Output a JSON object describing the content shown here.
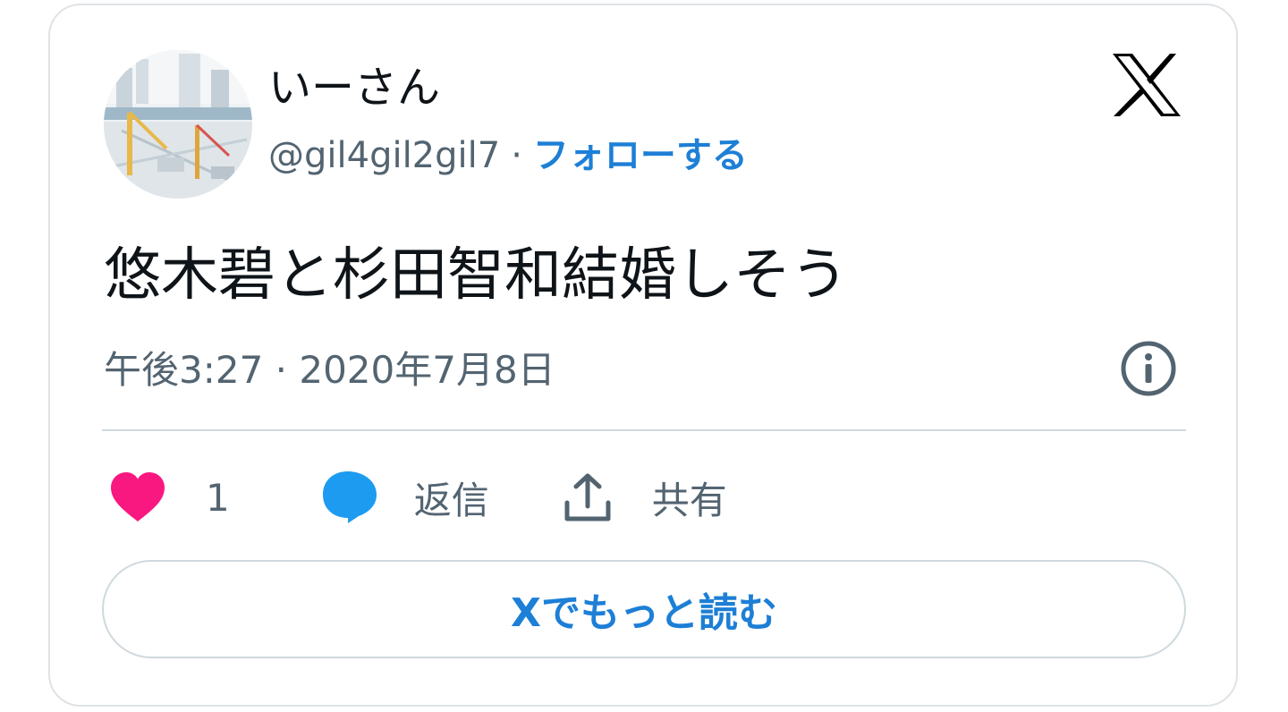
{
  "author": {
    "display_name": "いーさん",
    "handle": "@gil4gil2gil7",
    "separator": "·",
    "follow_label": "フォローする"
  },
  "tweet": {
    "text": "悠木碧と杉田智和結婚しそう",
    "timestamp": "午後3:27 · 2020年7月8日"
  },
  "actions": {
    "like_count": "1",
    "reply_label": "返信",
    "share_label": "共有"
  },
  "read_more_label": "Xでもっと読む",
  "icons": {
    "logo": "x-logo-icon",
    "info": "info-icon",
    "like": "heart-icon",
    "reply": "speech-bubble-icon",
    "share": "share-upload-icon"
  },
  "colors": {
    "heart": "#f91880",
    "reply": "#1d9bf0",
    "link": "#1d7fd6",
    "muted_text": "#536471",
    "text": "#0f1419",
    "border": "#cfd9de"
  }
}
